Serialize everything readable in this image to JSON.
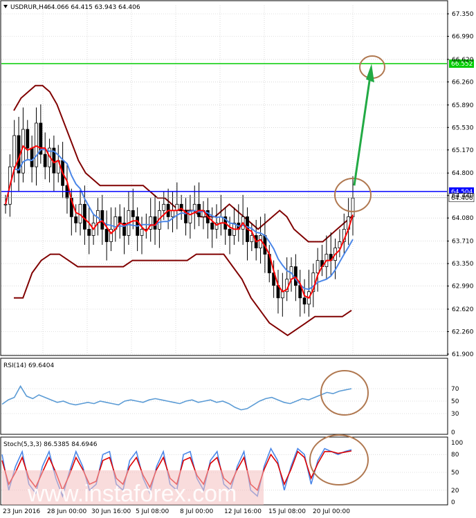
{
  "colors": {
    "candle": "#000000",
    "bb": "#800000",
    "sma_red": "#ff0000",
    "sma_blue": "#4a86e8",
    "hline_blue": "#0000ff",
    "hline_green": "#00cc00",
    "arrow": "#22aa44",
    "circle": "#b07850",
    "rsi": "#5b9bd5",
    "stoch_main": "#4a86e8",
    "stoch_sig": "#dd0000",
    "grid": "#c0c0c0",
    "price_tag_blue": "#0000ff",
    "price_tag_green": "#00cc00"
  },
  "header": {
    "icon": "triangle-down-icon",
    "symbol": "USDRUR,H4",
    "ohlc": "64.066 64.415 63.943 64.406"
  },
  "chart_data": [
    {
      "type": "candlestick",
      "title": "USDRUR,H4",
      "ylim": [
        61.9,
        67.35
      ],
      "y_ticks": [
        "67.350",
        "66.990",
        "66.620",
        "66.260",
        "65.890",
        "65.530",
        "65.170",
        "64.800",
        "64.440",
        "64.080",
        "63.710",
        "63.350",
        "62.990",
        "62.620",
        "62.260",
        "61.900"
      ],
      "x_ticks": [
        "23 Jun 2016",
        "28 Jun 00:00",
        "30 Jun 16:00",
        "5 Jul 08:00",
        "8 Jul 00:00",
        "12 Jul 16:00",
        "15 Jul 08:00",
        "20 Jul 00:00"
      ],
      "horizontal_lines": [
        {
          "value": 64.504,
          "label": "64.504",
          "color": "blue"
        },
        {
          "value": 66.552,
          "label": "66.552",
          "color": "green"
        }
      ],
      "current_price": {
        "value": 64.406,
        "label": "64.406"
      },
      "closes": [
        64.3,
        64.9,
        65.4,
        64.8,
        65.5,
        65.2,
        64.9,
        65.6,
        65.1,
        64.9,
        65.2,
        64.8,
        65.0,
        64.6,
        64.4,
        64.1,
        64.0,
        64.3,
        63.9,
        63.8,
        64.0,
        64.2,
        63.9,
        63.7,
        63.9,
        64.1,
        64.0,
        63.8,
        64.2,
        64.1,
        63.8,
        63.9,
        63.9,
        64.1,
        63.9,
        64.2,
        64.3,
        64.1,
        64.2,
        64.3,
        64.2,
        64.0,
        64.2,
        64.3,
        64.1,
        64.2,
        64.0,
        63.9,
        64.0,
        64.1,
        63.9,
        63.8,
        64.0,
        63.9,
        64.1,
        63.7,
        63.8,
        63.6,
        63.8,
        63.5,
        63.2,
        63.0,
        62.8,
        62.9,
        63.1,
        63.3,
        63.0,
        62.8,
        62.7,
        62.9,
        63.2,
        63.4,
        63.3,
        63.5,
        63.4,
        63.6,
        63.7,
        63.9,
        64.1,
        64.4
      ],
      "bollinger_upper": [
        65.8,
        66.0,
        66.1,
        66.2,
        66.2,
        66.1,
        65.9,
        65.6,
        65.3,
        65.0,
        64.8,
        64.7,
        64.6,
        64.6,
        64.6,
        64.6,
        64.6,
        64.6,
        64.6,
        64.5,
        64.4,
        64.4,
        64.3,
        64.2,
        64.2,
        64.2,
        64.1,
        64.1,
        64.1,
        64.2,
        64.3,
        64.2,
        64.1,
        64.0,
        63.9,
        64.0,
        64.1,
        64.2,
        64.1,
        63.9,
        63.8,
        63.7,
        63.7,
        63.7,
        63.8,
        63.9,
        64.0,
        64.1
      ],
      "bollinger_lower": [
        62.8,
        62.8,
        63.2,
        63.4,
        63.5,
        63.5,
        63.4,
        63.3,
        63.3,
        63.3,
        63.3,
        63.3,
        63.3,
        63.4,
        63.4,
        63.4,
        63.4,
        63.4,
        63.4,
        63.4,
        63.5,
        63.5,
        63.5,
        63.5,
        63.3,
        63.1,
        62.8,
        62.6,
        62.4,
        62.3,
        62.2,
        62.3,
        62.4,
        62.5,
        62.5,
        62.5,
        62.5,
        62.6
      ],
      "annotations": [
        "circle near 66.552",
        "circle near 64.504",
        "green arrow up from 64.5 toward 66.5"
      ]
    },
    {
      "type": "line",
      "title": "RSI(14) 69.6404",
      "ylim": [
        0,
        100
      ],
      "y_ticks": [
        "70",
        "50",
        "30",
        "0"
      ],
      "values": [
        45,
        52,
        56,
        74,
        58,
        54,
        60,
        56,
        52,
        48,
        50,
        46,
        44,
        46,
        48,
        46,
        50,
        48,
        46,
        44,
        50,
        52,
        50,
        48,
        52,
        54,
        52,
        50,
        48,
        46,
        50,
        52,
        48,
        50,
        52,
        48,
        50,
        46,
        40,
        36,
        38,
        44,
        50,
        54,
        56,
        52,
        48,
        46,
        50,
        54,
        52,
        56,
        60,
        64,
        62,
        66,
        68,
        70
      ]
    },
    {
      "type": "line",
      "title": "Stoch(5,3,3) 86.5385 84.6946",
      "ylim": [
        0,
        100
      ],
      "y_ticks": [
        "100",
        "80",
        "50",
        "20",
        "0"
      ],
      "series": [
        {
          "values": [
            80,
            20,
            60,
            85,
            30,
            15,
            60,
            85,
            40,
            10,
            50,
            85,
            60,
            20,
            30,
            80,
            85,
            30,
            20,
            70,
            85,
            40,
            15,
            60,
            85,
            30,
            20,
            80,
            85,
            40,
            20,
            70,
            85,
            30,
            20,
            60,
            85,
            20,
            10,
            60,
            90,
            70,
            20,
            60,
            90,
            80,
            30,
            70,
            90,
            85,
            80,
            85,
            88
          ]
        },
        {
          "values": [
            70,
            30,
            50,
            75,
            40,
            25,
            50,
            75,
            50,
            20,
            45,
            75,
            55,
            30,
            35,
            70,
            75,
            40,
            30,
            60,
            75,
            45,
            25,
            55,
            75,
            40,
            30,
            70,
            75,
            45,
            30,
            65,
            75,
            40,
            30,
            55,
            75,
            30,
            20,
            55,
            80,
            65,
            30,
            55,
            85,
            75,
            40,
            65,
            85,
            85,
            82,
            84,
            86
          ]
        }
      ]
    }
  ],
  "watermark": "www.instaforex.com"
}
